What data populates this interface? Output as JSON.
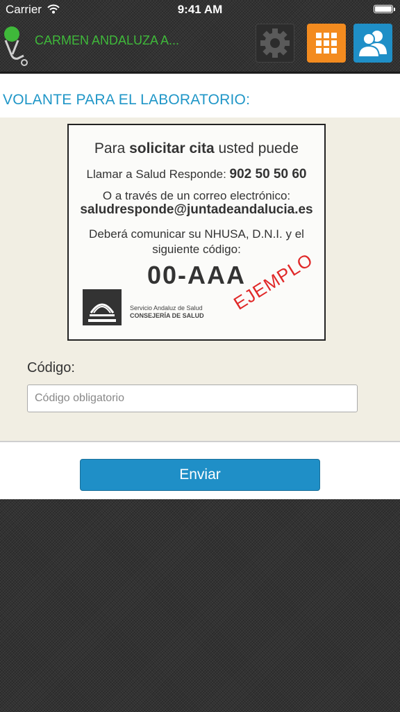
{
  "status_bar": {
    "carrier": "Carrier",
    "time": "9:41 AM",
    "battery_level": 1.0
  },
  "navbar": {
    "user_name": "CARMEN ANDALUZA A...",
    "colors": {
      "user_name": "#3fb93a",
      "grid_button": "#f38b1f",
      "user_button": "#1f8fc7"
    },
    "icons": [
      "stethoscope-icon",
      "gear-icon",
      "grid-icon",
      "users-icon"
    ]
  },
  "page": {
    "title": "VOLANTE PARA EL LABORATORIO:"
  },
  "example_card": {
    "line1_pre": "Para ",
    "line1_bold": "solicitar cita",
    "line1_post": " usted puede",
    "line2_text": "Llamar a Salud Responde: ",
    "line2_phone": "902 50 50 60",
    "line3": "O a través de un correo electrónico:",
    "line4_email": "saludresponde@juntadeandalucia.es",
    "line5a": "Deberá comunicar su NHUSA, D.N.I. y el",
    "line5b": "siguiente código:",
    "code": "00-AAA",
    "org_line1": "Servicio Andaluz de Salud",
    "org_line2": "CONSEJERÍA DE SALUD",
    "stamp": "EJEMPLO"
  },
  "form": {
    "code_label": "Código:",
    "code_placeholder": "Código obligatorio",
    "code_value": ""
  },
  "footer": {
    "send_label": "Enviar"
  }
}
